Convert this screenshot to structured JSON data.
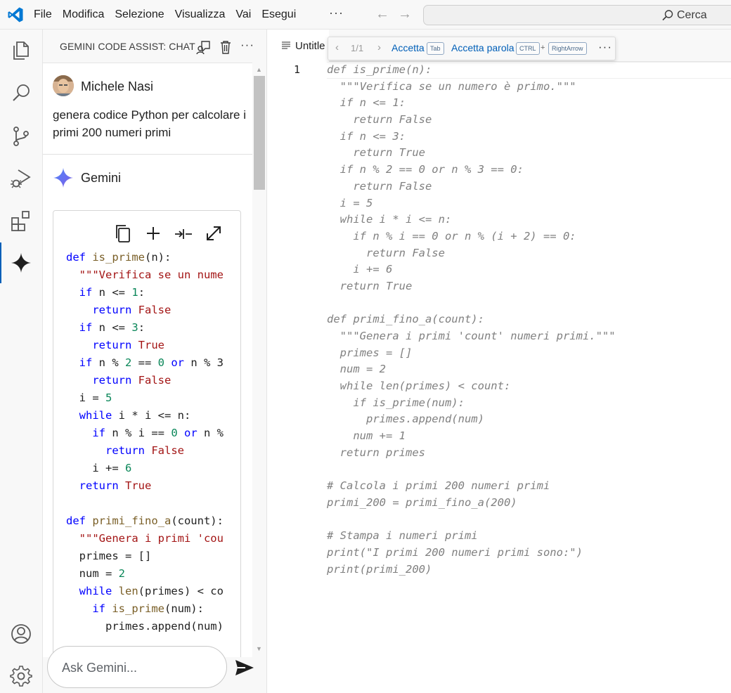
{
  "menu": [
    "File",
    "Modifica",
    "Selezione",
    "Visualizza",
    "Vai",
    "Esegui"
  ],
  "menu_more": "···",
  "search": {
    "label": "Cerca"
  },
  "panel": {
    "title": "GEMINI CODE ASSIST: CHAT",
    "more": "···"
  },
  "user_message": {
    "name": "Michele Nasi",
    "text": "genera codice Python per calcolare i primi 200 numeri primi"
  },
  "assistant": {
    "name": "Gemini"
  },
  "ask": {
    "placeholder": "Ask Gemini..."
  },
  "editor_tab": {
    "label": "Untitle"
  },
  "inline_toolbar": {
    "counter": "1/1",
    "accept": "Accetta",
    "accept_key": "Tab",
    "accept_word": "Accetta parola",
    "key_ctrl": "CTRL",
    "plus": "+",
    "key_right": "RightArrow",
    "more": "···"
  },
  "line_number": "1",
  "card_code_lines": [
    [
      [
        "kw",
        "def "
      ],
      [
        "fn",
        "is_prime"
      ],
      [
        "",
        "(n):"
      ]
    ],
    [
      [
        "st",
        "  \"\"\"Verifica se un nume"
      ]
    ],
    [
      [
        "kw",
        "  if "
      ],
      [
        "",
        "n <= "
      ],
      [
        "nm",
        "1"
      ],
      [
        "",
        ":"
      ]
    ],
    [
      [
        "kw",
        "    return "
      ],
      [
        "st",
        "False"
      ]
    ],
    [
      [
        "kw",
        "  if "
      ],
      [
        "",
        "n <= "
      ],
      [
        "nm",
        "3"
      ],
      [
        "",
        ":"
      ]
    ],
    [
      [
        "kw",
        "    return "
      ],
      [
        "st",
        "True"
      ]
    ],
    [
      [
        "kw",
        "  if "
      ],
      [
        "",
        "n % "
      ],
      [
        "nm",
        "2"
      ],
      [
        "",
        " == "
      ],
      [
        "nm",
        "0"
      ],
      [
        "kw",
        " or "
      ],
      [
        "",
        "n % 3"
      ]
    ],
    [
      [
        "kw",
        "    return "
      ],
      [
        "st",
        "False"
      ]
    ],
    [
      [
        "",
        "  i = "
      ],
      [
        "nm",
        "5"
      ]
    ],
    [
      [
        "kw",
        "  while "
      ],
      [
        "",
        "i * i <= n:"
      ]
    ],
    [
      [
        "kw",
        "    if "
      ],
      [
        "",
        "n % i == "
      ],
      [
        "nm",
        "0"
      ],
      [
        "kw",
        " or "
      ],
      [
        "",
        "n %"
      ]
    ],
    [
      [
        "kw",
        "      return "
      ],
      [
        "st",
        "False"
      ]
    ],
    [
      [
        "",
        "    i += "
      ],
      [
        "nm",
        "6"
      ]
    ],
    [
      [
        "kw",
        "  return "
      ],
      [
        "st",
        "True"
      ]
    ],
    [
      [
        "",
        ""
      ]
    ],
    [
      [
        "kw",
        "def "
      ],
      [
        "fn",
        "primi_fino_a"
      ],
      [
        "",
        "(count):"
      ]
    ],
    [
      [
        "st",
        "  \"\"\"Genera i primi 'cou"
      ]
    ],
    [
      [
        "",
        "  primes = []"
      ]
    ],
    [
      [
        "",
        "  num = "
      ],
      [
        "nm",
        "2"
      ]
    ],
    [
      [
        "kw",
        "  while "
      ],
      [
        "fn",
        "len"
      ],
      [
        "",
        "(primes) < co"
      ]
    ],
    [
      [
        "kw",
        "    if "
      ],
      [
        "fn",
        "is_prime"
      ],
      [
        "",
        "(num):"
      ]
    ],
    [
      [
        "",
        "      primes.append(num)"
      ]
    ]
  ],
  "editor_code_lines": [
    "def is_prime(n):",
    "  \"\"\"Verifica se un numero è primo.\"\"\"",
    "  if n <= 1:",
    "    return False",
    "  if n <= 3:",
    "    return True",
    "  if n % 2 == 0 or n % 3 == 0:",
    "    return False",
    "  i = 5",
    "  while i * i <= n:",
    "    if n % i == 0 or n % (i + 2) == 0:",
    "      return False",
    "    i += 6",
    "  return True",
    "",
    "def primi_fino_a(count):",
    "  \"\"\"Genera i primi 'count' numeri primi.\"\"\"",
    "  primes = []",
    "  num = 2",
    "  while len(primes) < count:",
    "    if is_prime(num):",
    "      primes.append(num)",
    "    num += 1",
    "  return primes",
    "",
    "# Calcola i primi 200 numeri primi",
    "primi_200 = primi_fino_a(200)",
    "",
    "# Stampa i numeri primi",
    "print(\"I primi 200 numeri primi sono:\")",
    "print(primi_200)"
  ],
  "colors": {
    "accent": "#005fb8",
    "keyword": "#0000ff",
    "function": "#795e26",
    "string": "#a31515",
    "number": "#098658",
    "ghost": "#808080"
  }
}
